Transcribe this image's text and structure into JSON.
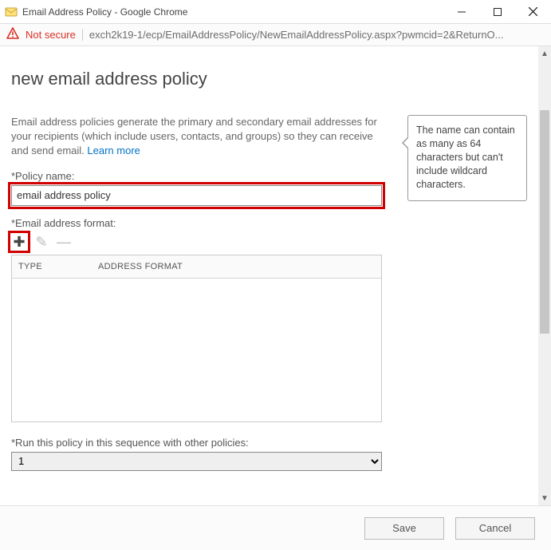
{
  "window": {
    "title": "Email Address Policy - Google Chrome"
  },
  "address_bar": {
    "security_label": "Not secure",
    "url": "exch2k19-1/ecp/EmailAddressPolicy/NewEmailAddressPolicy.aspx?pwmcid=2&ReturnO..."
  },
  "page": {
    "heading": "new email address policy",
    "intro_text": "Email address policies generate the primary and secondary email addresses for your recipients (which include users, contacts, and groups) so they can receive and send email. ",
    "learn_more": "Learn more"
  },
  "fields": {
    "policy_name_label": "*Policy name:",
    "policy_name_value": "email address policy",
    "email_format_label": "*Email address format:",
    "sequence_label": "*Run this policy in this sequence with other policies:",
    "sequence_value": "1"
  },
  "grid": {
    "col_type": "TYPE",
    "col_format": "ADDRESS FORMAT"
  },
  "tooltip": {
    "text": "The name can contain as many as 64 characters but can't include wildcard characters."
  },
  "buttons": {
    "save": "Save",
    "cancel": "Cancel"
  }
}
